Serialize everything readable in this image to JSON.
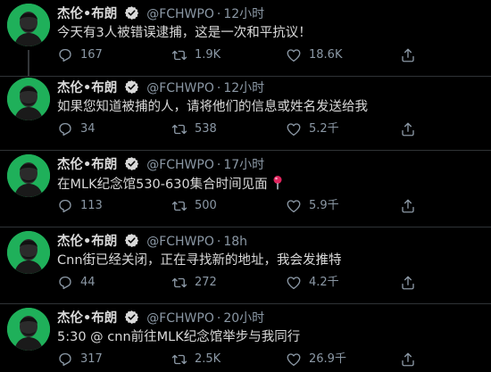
{
  "tweets": [
    {
      "name": "杰伦•布朗",
      "handle": "@FCHWPO",
      "separator": "·",
      "time": "12小时",
      "text": "今天有3人被错误逮捕，这是一次和平抗议！",
      "replies": "167",
      "retweets": "1.9K",
      "likes": "18.6K",
      "emoji": ""
    },
    {
      "name": "杰伦•布朗",
      "handle": "@FCHWPO",
      "separator": "·",
      "time": "12小时",
      "text": "如果您知道被捕的人，请将他们的信息或姓名发送给我",
      "replies": "34",
      "retweets": "538",
      "likes": "5.2千",
      "emoji": ""
    },
    {
      "name": "杰伦•布朗",
      "handle": "@FCHWPO",
      "separator": "·",
      "time": "17小时",
      "text": "在MLK纪念馆530-630集合时间见面",
      "replies": "113",
      "retweets": "500",
      "likes": "5.9千",
      "emoji": "round-pushpin"
    },
    {
      "name": "杰伦•布朗",
      "handle": "@FCHWPO",
      "separator": "·",
      "time": "18h",
      "text": "Cnn街已经关闭，正在寻找新的地址，我会发推特",
      "replies": "44",
      "retweets": "272",
      "likes": "4.2千",
      "emoji": ""
    },
    {
      "name": "杰伦•布朗",
      "handle": "@FCHWPO",
      "separator": "·",
      "time": "20小时",
      "text": "5:30 @ cnn前往MLK纪念馆举步与我同行",
      "replies": "317",
      "retweets": "2.5K",
      "likes": "26.9千",
      "emoji": ""
    }
  ],
  "colors": {
    "background": "#000000",
    "avatar": "#1fb05a",
    "verified": "#d9d9d9",
    "muted": "#8b98a5",
    "pin": "#e0245e"
  },
  "icons": [
    "reply-icon",
    "retweet-icon",
    "like-icon",
    "share-icon",
    "verified-badge-icon",
    "pushpin-icon"
  ]
}
